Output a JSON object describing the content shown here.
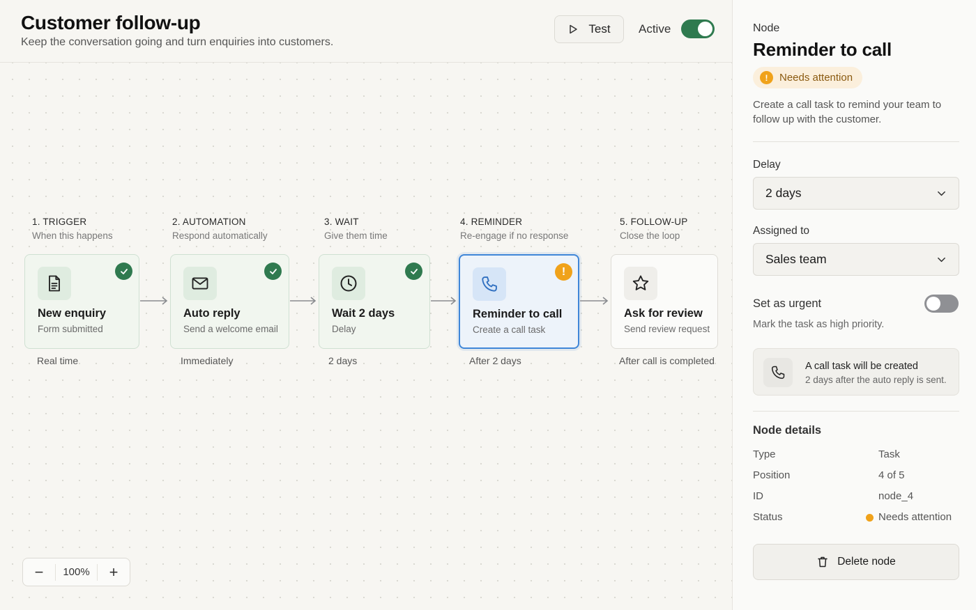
{
  "header": {
    "title": "Customer follow-up",
    "subtitle": "Keep the conversation going and turn enquiries into customers.",
    "test_label": "Test",
    "active_label": "Active",
    "active": true
  },
  "steps": [
    {
      "head": "1. TRIGGER",
      "sub": "When this happens",
      "title": "New enquiry",
      "desc": "Form submitted",
      "timing": "Real time",
      "icon": "document-icon",
      "status": "complete"
    },
    {
      "head": "2. AUTOMATION",
      "sub": "Respond automatically",
      "title": "Auto reply",
      "desc": "Send a welcome email",
      "timing": "Immediately",
      "icon": "mail-icon",
      "status": "complete"
    },
    {
      "head": "3. WAIT",
      "sub": "Give them time",
      "title": "Wait 2 days",
      "desc": "Delay",
      "timing": "2 days",
      "icon": "clock-icon",
      "status": "complete"
    },
    {
      "head": "4. REMINDER",
      "sub": "Re-engage if no response",
      "title": "Reminder to call",
      "desc": "Create a call task",
      "timing": "After 2 days",
      "icon": "phone-icon",
      "status": "warning"
    },
    {
      "head": "5. FOLLOW-UP",
      "sub": "Close the loop",
      "title": "Ask for review",
      "desc": "Send review request",
      "timing": "After call is completed",
      "icon": "star-icon",
      "status": "none"
    }
  ],
  "zoom": {
    "value": "100%",
    "minus": "−",
    "plus": "+"
  },
  "panel": {
    "kicker": "Node",
    "title": "Reminder to call",
    "status_pill": "Needs attention",
    "status_mark": "!",
    "description": "Create a call task to remind your team to follow up with the customer.",
    "delay_label": "Delay",
    "delay_value": "2 days",
    "assigned_label": "Assigned to",
    "assigned_value": "Sales team",
    "urgent_label": "Set as urgent",
    "urgent_on": false,
    "urgent_hint": "Mark the task as high priority.",
    "info_title": "A call task will be created",
    "info_sub": "2 days after the auto reply is sent.",
    "details_title": "Node details",
    "details": [
      {
        "key": "Type",
        "value": "Task"
      },
      {
        "key": "Position",
        "value": "4 of 5"
      },
      {
        "key": "ID",
        "value": "node_4"
      },
      {
        "key": "Status",
        "value": "Needs attention"
      }
    ],
    "delete_label": "Delete node"
  },
  "colors": {
    "success": "#2f7a4f",
    "warning": "#f0a21a",
    "selected": "#3f86d8"
  }
}
